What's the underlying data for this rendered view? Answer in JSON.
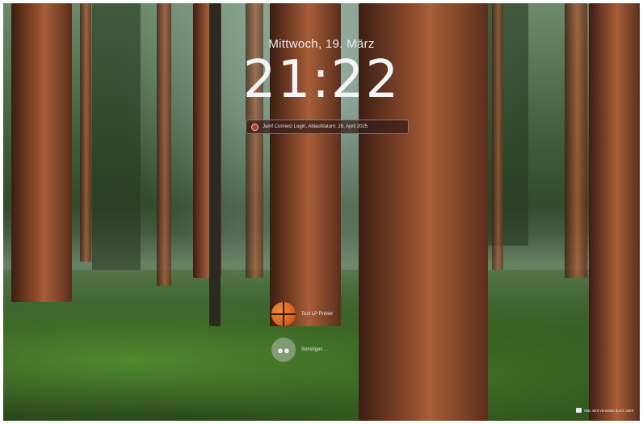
{
  "lock_screen": {
    "date": "Mittwoch, 19. März",
    "time": "21:22"
  },
  "notification": {
    "icon": "jamf-connect-icon",
    "text": "Jamf Connect Login, Ablaufdatum: 26. April 2025"
  },
  "users": [
    {
      "name": "Test LP Printer",
      "avatar": "basketball-avatar"
    },
    {
      "name": "Sonstiges ...",
      "avatar": "generic-users-icon"
    }
  ],
  "footer": {
    "icon": "device-management-icon",
    "text": "Mac wird verwaltet durch Jamf"
  },
  "colors": {
    "banner_border": "#c88c82",
    "banner_icon": "#c0392b",
    "text": "#f2f4f5"
  }
}
